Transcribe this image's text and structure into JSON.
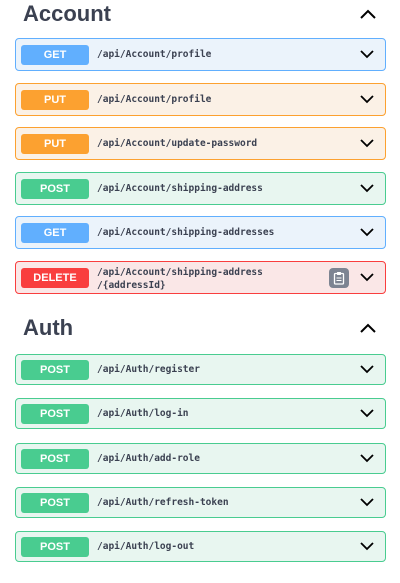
{
  "sections": [
    {
      "title": "Account",
      "operations": [
        {
          "method": "GET",
          "path": "/api/Account/profile"
        },
        {
          "method": "PUT",
          "path": "/api/Account/profile"
        },
        {
          "method": "PUT",
          "path": "/api/Account/update-password"
        },
        {
          "method": "POST",
          "path": "/api/Account/shipping-address"
        },
        {
          "method": "GET",
          "path": "/api/Account/shipping-addresses"
        },
        {
          "method": "DELETE",
          "path_line1": "/api/Account/shipping-address",
          "path_line2": "/{addressId}"
        }
      ]
    },
    {
      "title": "Auth",
      "operations": [
        {
          "method": "POST",
          "path": "/api/Auth/register"
        },
        {
          "method": "POST",
          "path": "/api/Auth/log-in"
        },
        {
          "method": "POST",
          "path": "/api/Auth/add-role"
        },
        {
          "method": "POST",
          "path": "/api/Auth/refresh-token"
        },
        {
          "method": "POST",
          "path": "/api/Auth/log-out"
        }
      ]
    }
  ],
  "icons": {
    "collapse": "chevron-up-icon",
    "expand": "chevron-down-icon",
    "copy": "copy-icon"
  },
  "colors": {
    "get": "#61affe",
    "put": "#fca130",
    "post": "#49cc90",
    "delete": "#f93e3e"
  }
}
